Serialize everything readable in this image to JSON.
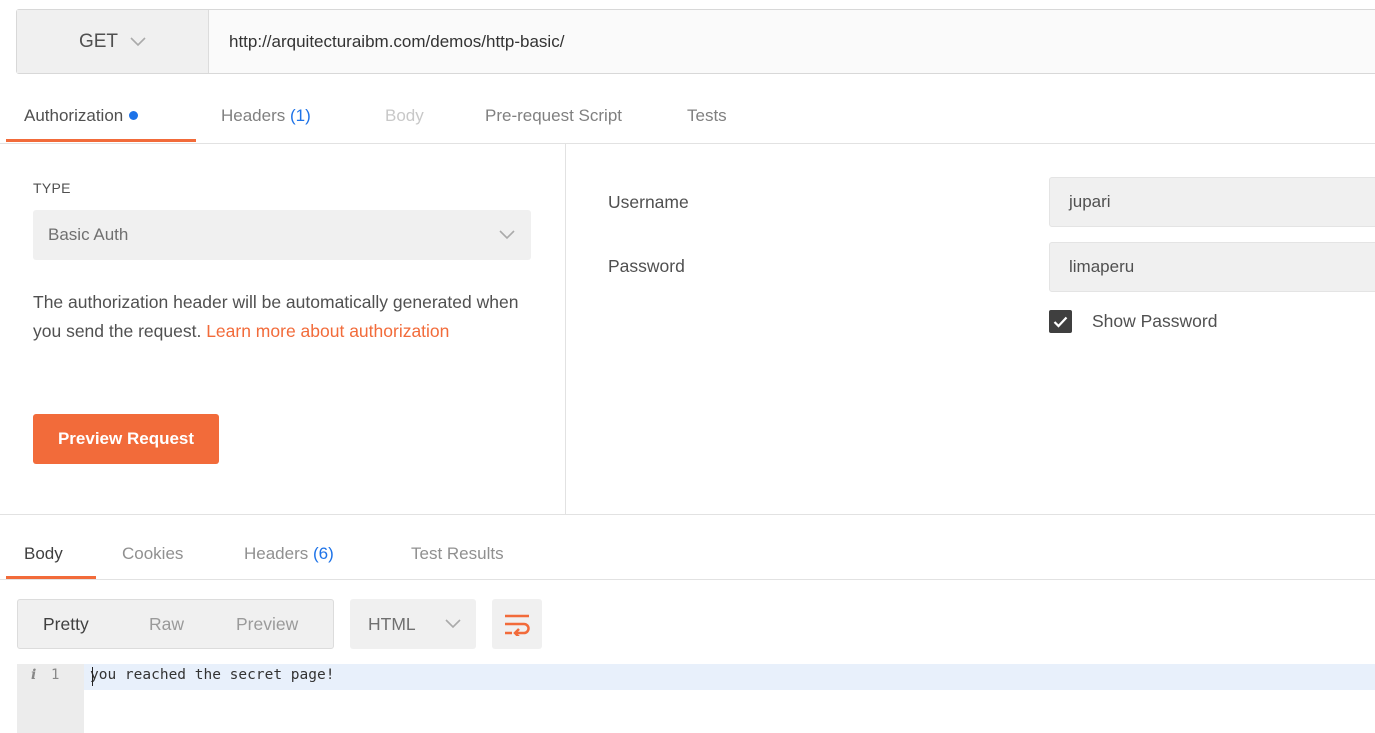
{
  "request": {
    "method": "GET",
    "url": "http://arquitecturaibm.com/demos/http-basic/"
  },
  "request_tabs": [
    {
      "label": "Authorization",
      "active": true,
      "has_dot": true
    },
    {
      "label": "Headers",
      "count": "(1)"
    },
    {
      "label": "Body",
      "disabled": true
    },
    {
      "label": "Pre-request Script"
    },
    {
      "label": "Tests"
    }
  ],
  "auth": {
    "type_label": "TYPE",
    "type_value": "Basic Auth",
    "description": "The authorization header will be automatically generated when you send the request.",
    "learn_more_link": "Learn more about authorization",
    "preview_button": "Preview Request",
    "username_label": "Username",
    "username_value": "jupari",
    "password_label": "Password",
    "password_value": "limaperu",
    "show_password_label": "Show Password",
    "show_password_checked": true
  },
  "response_tabs": [
    {
      "label": "Body",
      "active": true
    },
    {
      "label": "Cookies"
    },
    {
      "label": "Headers",
      "count": "(6)"
    },
    {
      "label": "Test Results"
    }
  ],
  "response_view": {
    "modes": [
      "Pretty",
      "Raw",
      "Preview"
    ],
    "selected_mode": "Pretty",
    "format": "HTML",
    "wrap_icon": "wrap-lines-icon"
  },
  "response_body": {
    "info_marker": "i",
    "line_number": "1",
    "line_text": "you reached the secret page!"
  },
  "colors": {
    "accent": "#f26b3a",
    "blue": "#1e73e8",
    "panel_bg": "#f0f0f0"
  }
}
